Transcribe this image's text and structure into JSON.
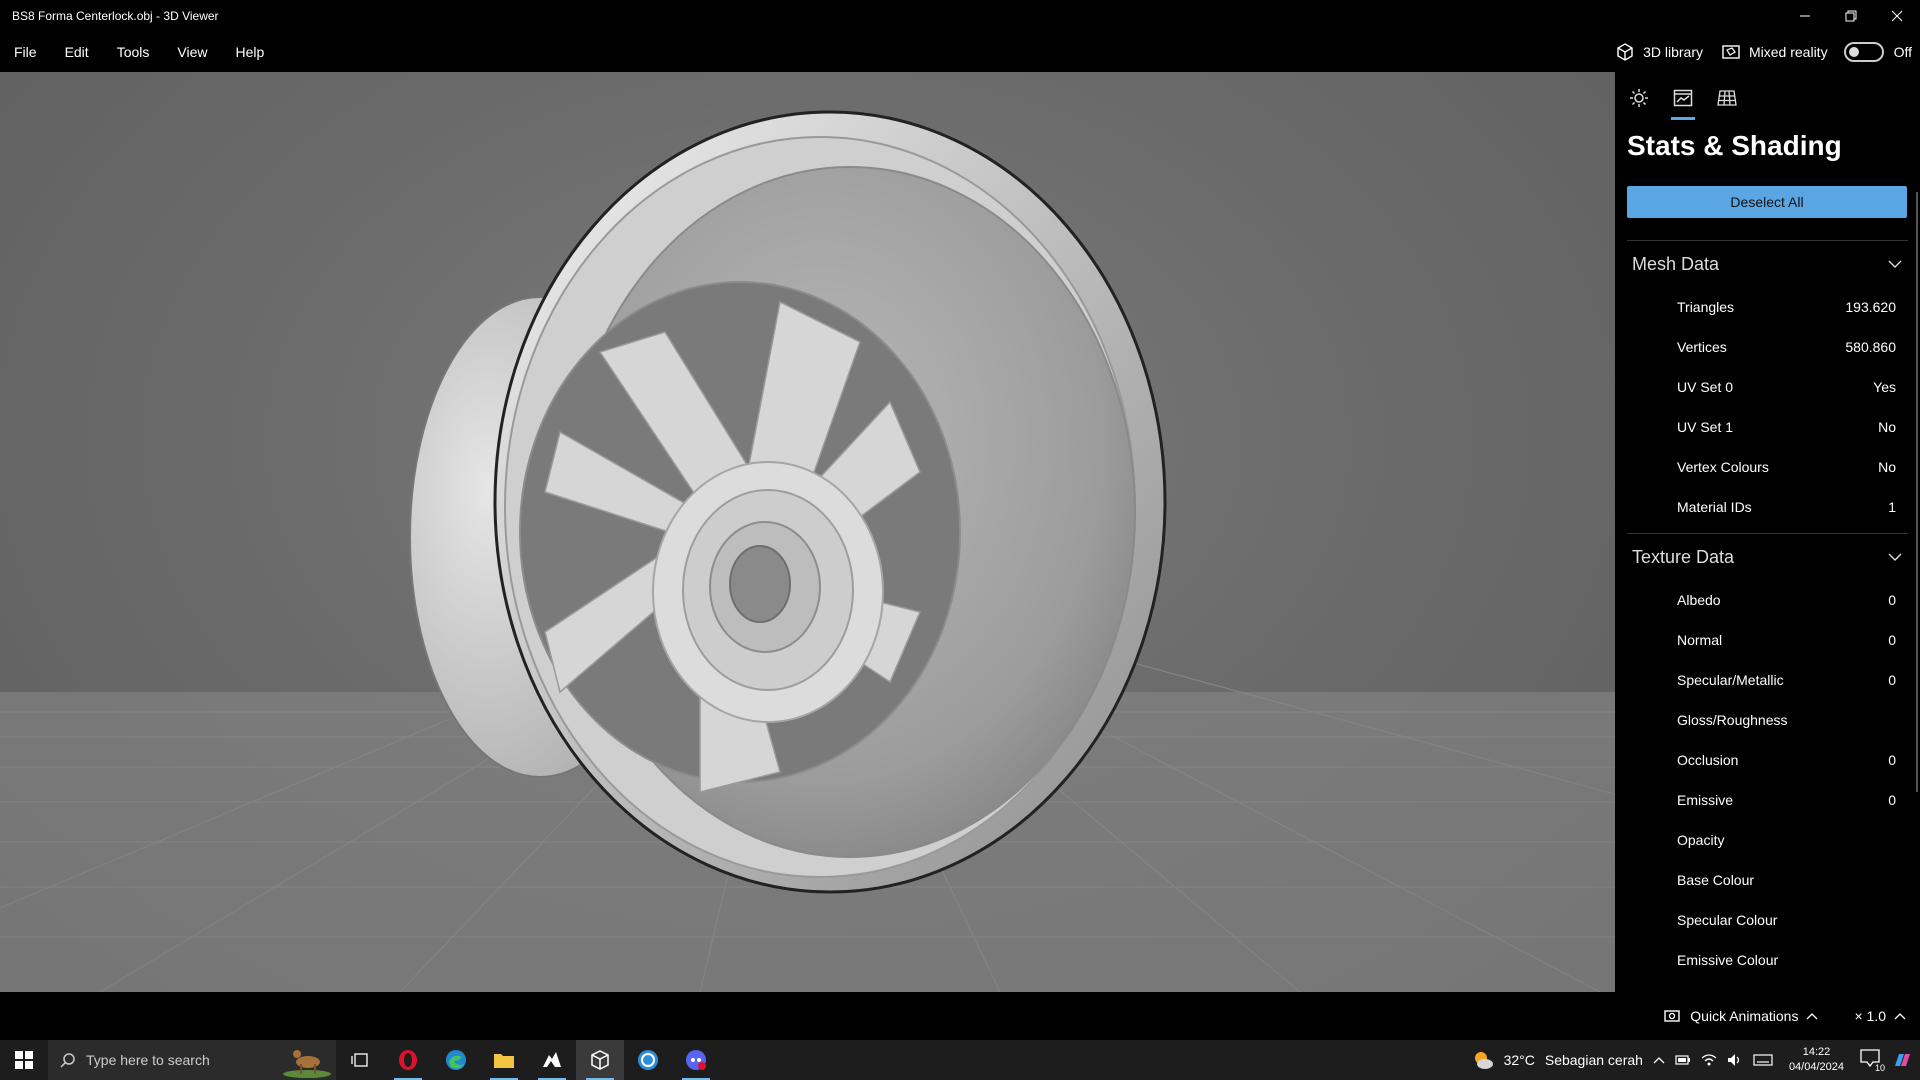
{
  "window": {
    "title": "BS8 Forma Centerlock.obj - 3D Viewer",
    "minimize_icon": "minimize-icon",
    "restore_icon": "restore-icon",
    "close_icon": "close-icon"
  },
  "menu": {
    "items": [
      "File",
      "Edit",
      "Tools",
      "View",
      "Help"
    ],
    "library_label": "3D library",
    "mixed_reality_label": "Mixed reality",
    "mixed_reality_state": "Off"
  },
  "panel": {
    "tabs": [
      "lighting-tab",
      "stats-tab",
      "grid-tab"
    ],
    "active_tab": "stats-tab",
    "title": "Stats & Shading",
    "deselect_label": "Deselect All",
    "mesh_section": "Mesh Data",
    "mesh_rows": [
      {
        "label": "Triangles",
        "value": "193.620"
      },
      {
        "label": "Vertices",
        "value": "580.860"
      },
      {
        "label": "UV Set 0",
        "value": "Yes"
      },
      {
        "label": "UV Set 1",
        "value": "No"
      },
      {
        "label": "Vertex Colours",
        "value": "No"
      },
      {
        "label": "Material IDs",
        "value": "1"
      }
    ],
    "texture_section": "Texture Data",
    "texture_rows": [
      {
        "label": "Albedo",
        "value": "0"
      },
      {
        "label": "Normal",
        "value": "0"
      },
      {
        "label": "Specular/Metallic",
        "value": "0"
      },
      {
        "label": "Gloss/Roughness",
        "value": ""
      },
      {
        "label": "Occlusion",
        "value": "0"
      },
      {
        "label": "Emissive",
        "value": "0"
      },
      {
        "label": "Opacity",
        "value": ""
      },
      {
        "label": "Base Colour",
        "value": ""
      },
      {
        "label": "Specular Colour",
        "value": ""
      },
      {
        "label": "Emissive Colour",
        "value": ""
      }
    ]
  },
  "status": {
    "quick_animations": "Quick Animations",
    "speed": "× 1.0"
  },
  "taskbar": {
    "search_placeholder": "Type here to search",
    "weather_temp": "32°C",
    "weather_text": "Sebagian cerah",
    "time": "14:22",
    "date": "04/04/2024",
    "notifications": "10"
  },
  "colors": {
    "accent": "#5aa5e3",
    "viewport_bg": "#6c6c6c",
    "panel_bg": "#000000"
  }
}
